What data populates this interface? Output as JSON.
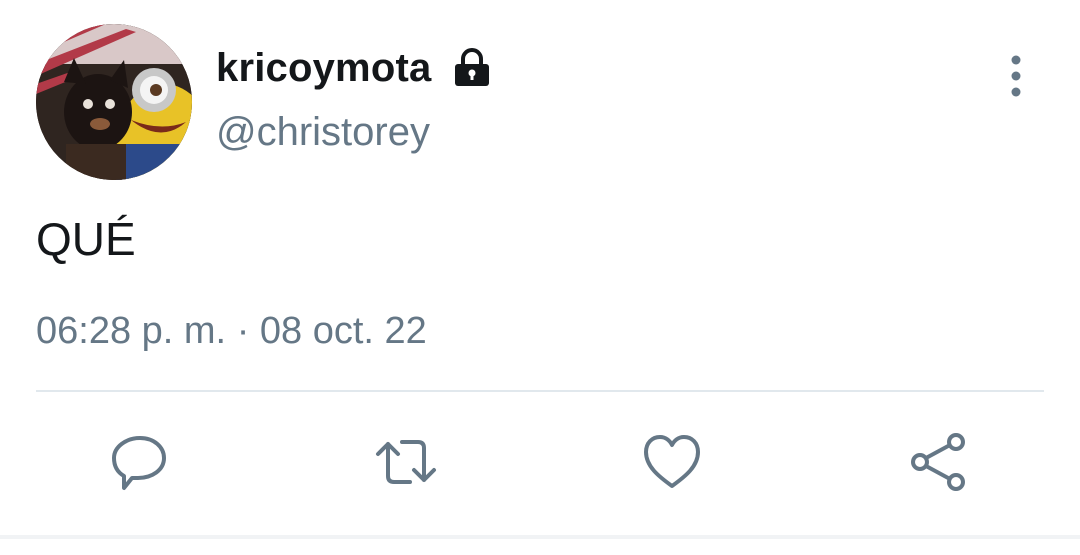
{
  "user": {
    "display_name": "kricoymota",
    "handle": "@christorey",
    "protected": true,
    "avatar_icon": "avatar-photo"
  },
  "tweet": {
    "text": "QUÉ",
    "time": "06:28 p. m.",
    "separator": "·",
    "date": "08 oct. 22"
  },
  "actions": [
    {
      "icon": "reply-icon"
    },
    {
      "icon": "retweet-icon"
    },
    {
      "icon": "like-icon"
    },
    {
      "icon": "share-icon"
    }
  ],
  "colors": {
    "text": "#14171a",
    "secondary": "#657786",
    "divider": "#e1e8ed"
  }
}
